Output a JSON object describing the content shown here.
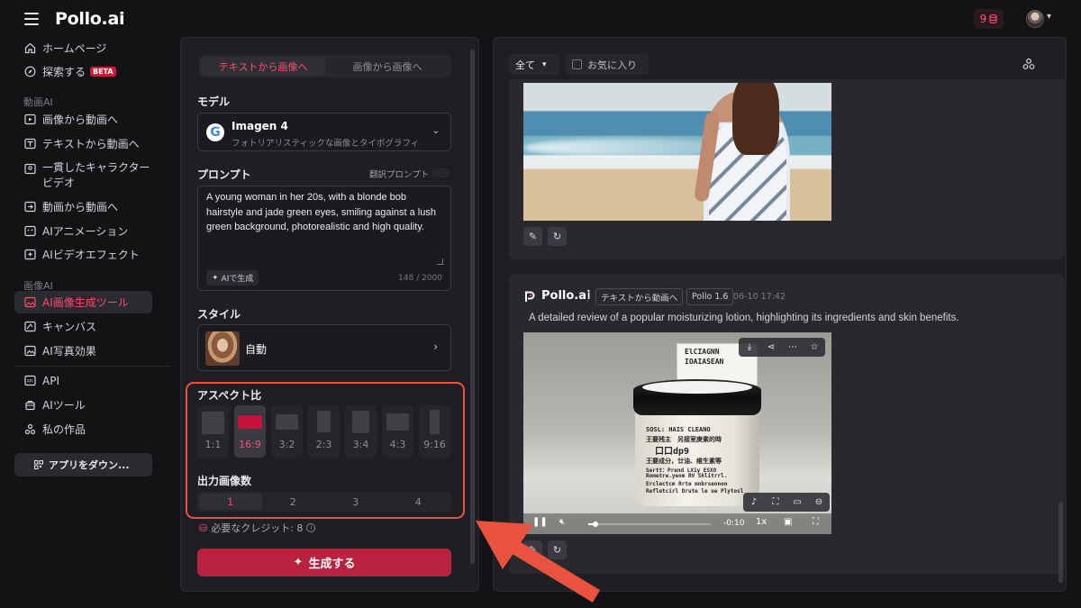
{
  "header": {
    "logo": "Pollo.ai",
    "credits": "9",
    "accent": "#ff4d6a"
  },
  "sidebar": {
    "home": "ホームページ",
    "explore": "探索する",
    "beta": "BETA",
    "section_video": "動画AI",
    "image_to_video": "画像から動画へ",
    "text_to_video": "テキストから動画へ",
    "consistent_character": "一貫したキャラクター",
    "consistent_character_2": "ビデオ",
    "video_to_video": "動画から動画へ",
    "ai_animation": "AIアニメーション",
    "ai_video_effects": "AIビデオエフェクト",
    "section_image": "画像AI",
    "ai_image_tool": "AI画像生成ツール",
    "canvas": "キャンバス",
    "ai_photo_effects": "AI写真効果",
    "api": "API",
    "ai_tools": "AIツール",
    "my_works": "私の作品",
    "download_app": "アプリをダウン..."
  },
  "generator": {
    "tabs": [
      "テキストから画像へ",
      "画像から画像へ"
    ],
    "model_label": "モデル",
    "model_name": "Imagen 4",
    "model_desc": "フォトリアリスティックな画像とタイポグラフィ",
    "prompt_label": "プロンプト",
    "translate_label": "翻訳プロンプト",
    "prompt_text": "A young woman in her 20s, with a blonde bob hairstyle and jade green eyes, smiling against a lush green background, photorealistic and high quality.",
    "ai_generate": "AIで生成",
    "char_count": "148 / 2000",
    "style_label": "スタイル",
    "style_value": "自動",
    "aspect_label": "アスペクト比",
    "aspect_ratios": [
      "1:1",
      "16:9",
      "3:2",
      "2:3",
      "3:4",
      "4:3",
      "9:16"
    ],
    "aspect_selected": "16:9",
    "count_label": "出力画像数",
    "counts": [
      "1",
      "2",
      "3",
      "4"
    ],
    "count_selected": "1",
    "credits_required": "必要なクレジット: 8",
    "generate_button": "生成する"
  },
  "gallery": {
    "filter": "全て",
    "favorites": "お気に入り",
    "card2": {
      "brand": "Pollo.ai",
      "mode": "テキストから動画へ",
      "model": "Pollo 1.6",
      "time": "06-10 17:42",
      "description": "A detailed review of a popular moisturizing lotion, highlighting its ingredients and skin benefits.",
      "jar_text": [
        "ElCIAGNN",
        "IOAIASEAN",
        "SOSL: HAIS CLEANO",
        "王要残主　另接室庚素的時",
        "口口dp9",
        "王要成分，廿油、维生素等",
        "Sertt：Prend LXiy ESXO",
        "Rometre.yenm RV Shlitrrl.",
        "Erclectcm Rrte mnbrsennon",
        "Refletcirl Drute le ue Plytosl"
      ],
      "time_remaining": "-0:10",
      "speed": "1x",
      "progress": 0.04
    }
  }
}
